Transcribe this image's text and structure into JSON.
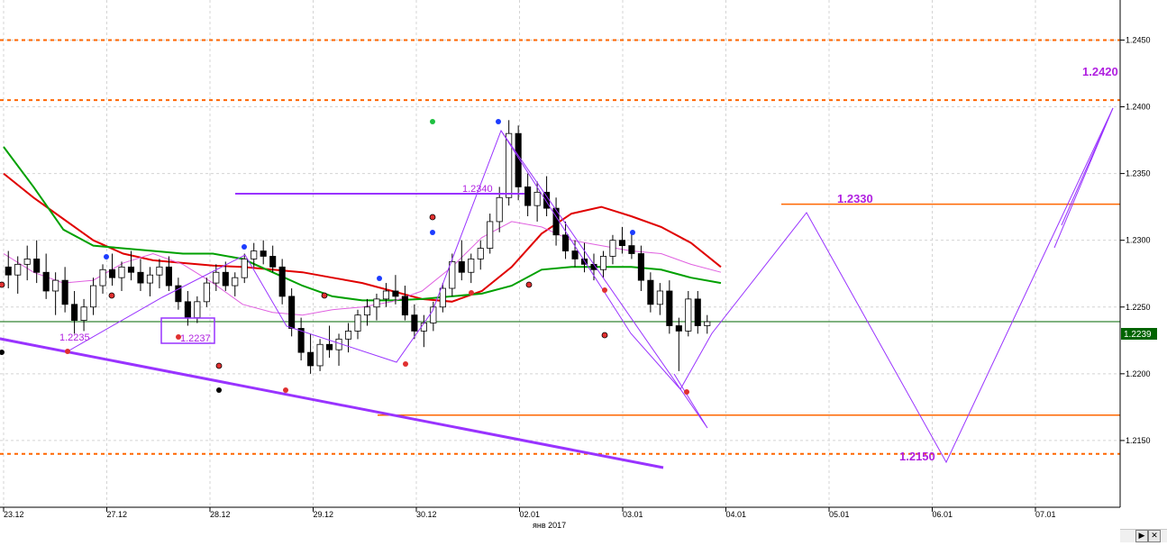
{
  "chart_data": {
    "type": "candlestick",
    "title": "",
    "x_ticks": [
      "23.12",
      "27.12",
      "28.12",
      "29.12",
      "30.12",
      "02.01",
      "03.01",
      "04.01",
      "05.01",
      "06.01",
      "07.01"
    ],
    "month_label": "янв 2017",
    "y_ticks": [
      "1.2150",
      "1.2200",
      "1.2250",
      "1.2300",
      "1.2350",
      "1.2400",
      "1.2450"
    ],
    "ylim": [
      1.21,
      1.248
    ],
    "current_price_label": "1.2239",
    "current_price": 1.2239,
    "grid": "dashed",
    "levels": {
      "resistance_dotted": [
        1.245,
        1.2405
      ],
      "support_dotted": [
        1.214
      ],
      "solid": [
        1.2327,
        1.2169
      ]
    },
    "annotations": {
      "target_up": "1.2420",
      "target_mid": "1.2330",
      "target_down": "1.2150",
      "low_1": "1.2235",
      "low_2": "1.2237",
      "level_1": "1.2340"
    },
    "candles": [
      {
        "o": 1.228,
        "h": 1.2292,
        "l": 1.2264,
        "c": 1.2274
      },
      {
        "o": 1.2274,
        "h": 1.2288,
        "l": 1.226,
        "c": 1.2282
      },
      {
        "o": 1.2282,
        "h": 1.2296,
        "l": 1.227,
        "c": 1.2286
      },
      {
        "o": 1.2286,
        "h": 1.23,
        "l": 1.2268,
        "c": 1.2276
      },
      {
        "o": 1.2276,
        "h": 1.229,
        "l": 1.2256,
        "c": 1.2262
      },
      {
        "o": 1.2262,
        "h": 1.2276,
        "l": 1.2244,
        "c": 1.227
      },
      {
        "o": 1.227,
        "h": 1.228,
        "l": 1.2246,
        "c": 1.2252
      },
      {
        "o": 1.2252,
        "h": 1.2262,
        "l": 1.223,
        "c": 1.224
      },
      {
        "o": 1.224,
        "h": 1.2256,
        "l": 1.2232,
        "c": 1.225
      },
      {
        "o": 1.225,
        "h": 1.2272,
        "l": 1.2244,
        "c": 1.2266
      },
      {
        "o": 1.2266,
        "h": 1.2282,
        "l": 1.226,
        "c": 1.2278
      },
      {
        "o": 1.2278,
        "h": 1.229,
        "l": 1.2266,
        "c": 1.2272
      },
      {
        "o": 1.2272,
        "h": 1.2284,
        "l": 1.2262,
        "c": 1.228
      },
      {
        "o": 1.228,
        "h": 1.2292,
        "l": 1.227,
        "c": 1.2276
      },
      {
        "o": 1.2276,
        "h": 1.2286,
        "l": 1.2262,
        "c": 1.2268
      },
      {
        "o": 1.2268,
        "h": 1.228,
        "l": 1.2258,
        "c": 1.2274
      },
      {
        "o": 1.2274,
        "h": 1.2286,
        "l": 1.2264,
        "c": 1.228
      },
      {
        "o": 1.228,
        "h": 1.2288,
        "l": 1.2262,
        "c": 1.2266
      },
      {
        "o": 1.2266,
        "h": 1.2272,
        "l": 1.2248,
        "c": 1.2254
      },
      {
        "o": 1.2254,
        "h": 1.2262,
        "l": 1.2236,
        "c": 1.2242
      },
      {
        "o": 1.2242,
        "h": 1.2258,
        "l": 1.2238,
        "c": 1.2254
      },
      {
        "o": 1.2254,
        "h": 1.2272,
        "l": 1.225,
        "c": 1.2268
      },
      {
        "o": 1.2268,
        "h": 1.2282,
        "l": 1.2262,
        "c": 1.2276
      },
      {
        "o": 1.2276,
        "h": 1.2284,
        "l": 1.2262,
        "c": 1.2266
      },
      {
        "o": 1.2266,
        "h": 1.2276,
        "l": 1.2258,
        "c": 1.2272
      },
      {
        "o": 1.2272,
        "h": 1.229,
        "l": 1.2268,
        "c": 1.2286
      },
      {
        "o": 1.2286,
        "h": 1.2298,
        "l": 1.228,
        "c": 1.2292
      },
      {
        "o": 1.2292,
        "h": 1.23,
        "l": 1.2282,
        "c": 1.2288
      },
      {
        "o": 1.2288,
        "h": 1.2296,
        "l": 1.2276,
        "c": 1.228
      },
      {
        "o": 1.228,
        "h": 1.2286,
        "l": 1.2252,
        "c": 1.2258
      },
      {
        "o": 1.2258,
        "h": 1.2264,
        "l": 1.2228,
        "c": 1.2234
      },
      {
        "o": 1.2234,
        "h": 1.2242,
        "l": 1.221,
        "c": 1.2216
      },
      {
        "o": 1.2216,
        "h": 1.223,
        "l": 1.22,
        "c": 1.2206
      },
      {
        "o": 1.2206,
        "h": 1.2226,
        "l": 1.2202,
        "c": 1.2222
      },
      {
        "o": 1.2222,
        "h": 1.2236,
        "l": 1.2212,
        "c": 1.2218
      },
      {
        "o": 1.2218,
        "h": 1.223,
        "l": 1.2206,
        "c": 1.2226
      },
      {
        "o": 1.2226,
        "h": 1.2238,
        "l": 1.2216,
        "c": 1.2232
      },
      {
        "o": 1.2232,
        "h": 1.2248,
        "l": 1.2226,
        "c": 1.2244
      },
      {
        "o": 1.2244,
        "h": 1.2256,
        "l": 1.2236,
        "c": 1.225
      },
      {
        "o": 1.225,
        "h": 1.226,
        "l": 1.224,
        "c": 1.2256
      },
      {
        "o": 1.2256,
        "h": 1.2268,
        "l": 1.225,
        "c": 1.2262
      },
      {
        "o": 1.2262,
        "h": 1.2274,
        "l": 1.2252,
        "c": 1.2258
      },
      {
        "o": 1.2258,
        "h": 1.2266,
        "l": 1.224,
        "c": 1.2244
      },
      {
        "o": 1.2244,
        "h": 1.2252,
        "l": 1.2226,
        "c": 1.2232
      },
      {
        "o": 1.2232,
        "h": 1.2244,
        "l": 1.222,
        "c": 1.2238
      },
      {
        "o": 1.2238,
        "h": 1.2254,
        "l": 1.2232,
        "c": 1.225
      },
      {
        "o": 1.225,
        "h": 1.2268,
        "l": 1.2246,
        "c": 1.2264
      },
      {
        "o": 1.2264,
        "h": 1.229,
        "l": 1.2258,
        "c": 1.2284
      },
      {
        "o": 1.2284,
        "h": 1.23,
        "l": 1.227,
        "c": 1.2276
      },
      {
        "o": 1.2276,
        "h": 1.229,
        "l": 1.2268,
        "c": 1.2286
      },
      {
        "o": 1.2286,
        "h": 1.23,
        "l": 1.2278,
        "c": 1.2294
      },
      {
        "o": 1.2294,
        "h": 1.232,
        "l": 1.229,
        "c": 1.2314
      },
      {
        "o": 1.2314,
        "h": 1.234,
        "l": 1.2306,
        "c": 1.2332
      },
      {
        "o": 1.2332,
        "h": 1.239,
        "l": 1.2326,
        "c": 1.238
      },
      {
        "o": 1.238,
        "h": 1.2386,
        "l": 1.233,
        "c": 1.234
      },
      {
        "o": 1.234,
        "h": 1.235,
        "l": 1.2318,
        "c": 1.2326
      },
      {
        "o": 1.2326,
        "h": 1.2344,
        "l": 1.2314,
        "c": 1.2336
      },
      {
        "o": 1.2336,
        "h": 1.2348,
        "l": 1.2318,
        "c": 1.2324
      },
      {
        "o": 1.2324,
        "h": 1.2332,
        "l": 1.2296,
        "c": 1.2304
      },
      {
        "o": 1.2304,
        "h": 1.2314,
        "l": 1.2286,
        "c": 1.2292
      },
      {
        "o": 1.2292,
        "h": 1.23,
        "l": 1.228,
        "c": 1.2286
      },
      {
        "o": 1.2286,
        "h": 1.2298,
        "l": 1.2276,
        "c": 1.2282
      },
      {
        "o": 1.2282,
        "h": 1.229,
        "l": 1.227,
        "c": 1.2278
      },
      {
        "o": 1.2278,
        "h": 1.2292,
        "l": 1.2272,
        "c": 1.2288
      },
      {
        "o": 1.2288,
        "h": 1.2304,
        "l": 1.2282,
        "c": 1.23
      },
      {
        "o": 1.23,
        "h": 1.231,
        "l": 1.229,
        "c": 1.2296
      },
      {
        "o": 1.2296,
        "h": 1.2306,
        "l": 1.2286,
        "c": 1.229
      },
      {
        "o": 1.229,
        "h": 1.2296,
        "l": 1.2262,
        "c": 1.227
      },
      {
        "o": 1.227,
        "h": 1.2276,
        "l": 1.2246,
        "c": 1.2252
      },
      {
        "o": 1.2252,
        "h": 1.2268,
        "l": 1.2244,
        "c": 1.2262
      },
      {
        "o": 1.2262,
        "h": 1.227,
        "l": 1.223,
        "c": 1.2236
      },
      {
        "o": 1.2236,
        "h": 1.2242,
        "l": 1.2202,
        "c": 1.2232
      },
      {
        "o": 1.2232,
        "h": 1.2262,
        "l": 1.2228,
        "c": 1.2256
      },
      {
        "o": 1.2256,
        "h": 1.2262,
        "l": 1.223,
        "c": 1.2236
      },
      {
        "o": 1.2236,
        "h": 1.2244,
        "l": 1.223,
        "c": 1.2239
      }
    ],
    "series": [
      {
        "name": "",
        "color": "#e00000",
        "values": [
          1.235,
          1.2332,
          1.2316,
          1.23,
          1.229,
          1.2285,
          1.2283,
          1.2281,
          1.228,
          1.2278,
          1.2276,
          1.2272,
          1.2268,
          1.2262,
          1.2256,
          1.2254,
          1.2262,
          1.228,
          1.2305,
          1.232,
          1.2325,
          1.2318,
          1.231,
          1.2298,
          1.228
        ]
      },
      {
        "name": "",
        "color": "#00a000",
        "values": [
          1.237,
          1.234,
          1.2308,
          1.2296,
          1.2294,
          1.2292,
          1.229,
          1.229,
          1.2286,
          1.2276,
          1.2266,
          1.2258,
          1.2255,
          1.2255,
          1.2256,
          1.2258,
          1.226,
          1.2266,
          1.2278,
          1.228,
          1.228,
          1.228,
          1.2278,
          1.2272,
          1.2268
        ]
      },
      {
        "name": "",
        "color": "#e060e0",
        "values": [
          1.229,
          1.2276,
          1.2268,
          1.227,
          1.2283,
          1.229,
          1.2282,
          1.2268,
          1.2252,
          1.2246,
          1.2244,
          1.2248,
          1.225,
          1.2254,
          1.2262,
          1.228,
          1.2302,
          1.2314,
          1.231,
          1.23,
          1.2296,
          1.2292,
          1.229,
          1.2282,
          1.2276
        ]
      }
    ],
    "colors": {
      "bull": "#ffffff",
      "bear": "#000000",
      "level": "#ff6600",
      "wave": "#9933ff",
      "label": "#b020e0",
      "price_tag": "#006400"
    }
  }
}
